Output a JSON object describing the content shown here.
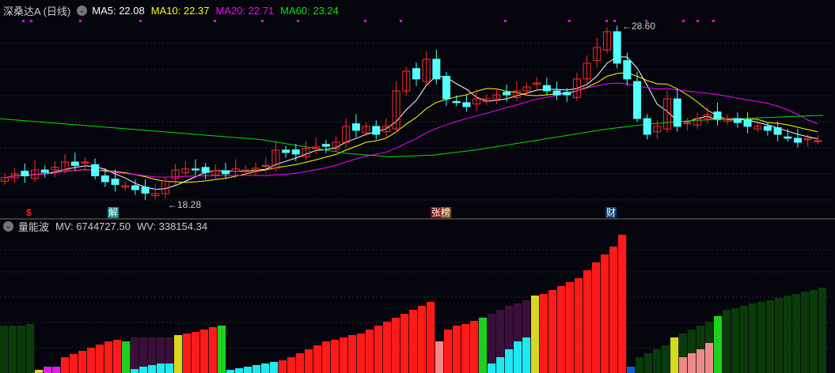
{
  "header": {
    "title": "深桑达A (日线)",
    "ma5": "MA5: 22.08",
    "ma10": "MA10: 22.37",
    "ma20": "MA20: 22.71",
    "ma60": "MA60: 23.24"
  },
  "colors": {
    "up": "#ff2b2b",
    "down": "#54ffff",
    "ma5": "#ffffff",
    "ma10": "#ffff00",
    "ma20": "#ff00ff",
    "ma60": "#00e000"
  },
  "price_annotations": {
    "high": "28.60",
    "low": "18.28"
  },
  "markers": [
    {
      "label": "$",
      "color": "#ff2020"
    },
    {
      "label": "解",
      "color": "#0e8a8a"
    },
    {
      "label": "张榜",
      "color": "#8a0a0a"
    },
    {
      "label": "财",
      "color": "#0a3f7a"
    }
  ],
  "indicator": {
    "name": "量能波",
    "mv": "MV: 6744727.50",
    "wv": "WV: 338154.34"
  },
  "chart_data": {
    "type": "candlestick",
    "close": [
      19.79,
      20.02,
      19.9,
      20.24,
      20.1,
      20.4,
      20.7,
      20.5,
      20.7,
      19.9,
      19.56,
      19.4,
      19.33,
      19.1,
      18.9,
      18.87,
      19.6,
      20.24,
      20.3,
      20.24,
      20.1,
      20.2,
      20.02,
      20.3,
      20.24,
      20.34,
      20.5,
      21.39,
      21.25,
      21.16,
      21.48,
      21.57,
      21.61,
      21.84,
      22.76,
      22.53,
      22.76,
      22.3,
      22.76,
      24.81,
      25.95,
      25.5,
      26.64,
      25.5,
      24.35,
      24.13,
      23.9,
      24.35,
      24.35,
      24.58,
      24.58,
      24.81,
      25.04,
      25.27,
      24.81,
      24.58,
      24.58,
      25.5,
      26.41,
      27.32,
      28.23,
      26.41,
      25.5,
      23.21,
      22.3,
      22.76,
      24.35,
      22.76,
      22.98,
      23.21,
      23.44,
      23.21,
      23.21,
      22.98,
      22.76,
      22.76,
      22.53,
      22.3,
      22.07,
      21.84,
      22.07,
      21.93
    ],
    "ma60": [
      23.2,
      23.0,
      22.8,
      22.6,
      22.4,
      22.2,
      22.0,
      21.6,
      21.2,
      21.0,
      21.1,
      21.4,
      21.8,
      22.2,
      22.6,
      22.9,
      23.1,
      23.2,
      23.3,
      23.4
    ],
    "high": 28.6,
    "low": 18.28,
    "volume_bars": [
      [
        60,
        "dg"
      ],
      [
        60,
        "dg"
      ],
      [
        60,
        "dg"
      ],
      [
        62,
        "dg"
      ],
      [
        4,
        "yl"
      ],
      [
        8,
        "mg"
      ],
      [
        8,
        "mg"
      ],
      [
        20,
        "rd"
      ],
      [
        24,
        "rd"
      ],
      [
        28,
        "rd"
      ],
      [
        32,
        "rd"
      ],
      [
        36,
        "rd"
      ],
      [
        40,
        "rd"
      ],
      [
        42,
        "rd"
      ],
      [
        40,
        "gr"
      ],
      [
        45,
        "pu",
        5
      ],
      [
        45,
        "pu",
        8
      ],
      [
        45,
        "pu",
        10
      ],
      [
        45,
        "pu",
        12
      ],
      [
        45,
        "pu",
        12
      ],
      [
        48,
        "yl"
      ],
      [
        50,
        "rd"
      ],
      [
        52,
        "rd"
      ],
      [
        55,
        "rd"
      ],
      [
        58,
        "rd"
      ],
      [
        60,
        "gr"
      ],
      [
        4,
        "cy"
      ],
      [
        6,
        "cy"
      ],
      [
        8,
        "cy"
      ],
      [
        10,
        "cy"
      ],
      [
        12,
        "cy"
      ],
      [
        14,
        "cy"
      ],
      [
        16,
        "rd"
      ],
      [
        20,
        "rd"
      ],
      [
        25,
        "rd"
      ],
      [
        30,
        "rd"
      ],
      [
        35,
        "rd"
      ],
      [
        40,
        "rd"
      ],
      [
        42,
        "rd"
      ],
      [
        45,
        "rd"
      ],
      [
        48,
        "rd"
      ],
      [
        50,
        "rd"
      ],
      [
        55,
        "rd"
      ],
      [
        60,
        "rd"
      ],
      [
        65,
        "rd"
      ],
      [
        70,
        "rd"
      ],
      [
        75,
        "rd"
      ],
      [
        80,
        "rd"
      ],
      [
        85,
        "rd"
      ],
      [
        90,
        "rd"
      ],
      [
        40,
        "pk"
      ],
      [
        55,
        "rd"
      ],
      [
        60,
        "rd"
      ],
      [
        62,
        "rd"
      ],
      [
        66,
        "rd"
      ],
      [
        70,
        "gr"
      ],
      [
        75,
        "pu",
        12
      ],
      [
        80,
        "pu",
        20
      ],
      [
        85,
        "pu",
        30
      ],
      [
        88,
        "pu",
        40
      ],
      [
        92,
        "pu",
        45
      ],
      [
        98,
        "yl"
      ],
      [
        100,
        "rd"
      ],
      [
        105,
        "rd"
      ],
      [
        110,
        "rd"
      ],
      [
        115,
        "rd"
      ],
      [
        120,
        "rd"
      ],
      [
        130,
        "rd"
      ],
      [
        140,
        "rd"
      ],
      [
        150,
        "rd"
      ],
      [
        160,
        "rd"
      ],
      [
        175,
        "rd"
      ],
      [
        8,
        "bl"
      ],
      [
        20,
        "dg"
      ],
      [
        25,
        "dg"
      ],
      [
        30,
        "dg"
      ],
      [
        35,
        "dg"
      ],
      [
        45,
        "yl"
      ],
      [
        50,
        "dg",
        20
      ],
      [
        55,
        "dg",
        25
      ],
      [
        60,
        "dg",
        30
      ],
      [
        65,
        "dg",
        38
      ],
      [
        72,
        "gr"
      ],
      [
        80,
        "dg"
      ],
      [
        82,
        "dg"
      ],
      [
        85,
        "dg"
      ],
      [
        88,
        "dg"
      ],
      [
        90,
        "dg"
      ],
      [
        92,
        "dg"
      ],
      [
        95,
        "dg"
      ],
      [
        98,
        "dg"
      ],
      [
        100,
        "dg"
      ],
      [
        103,
        "dg"
      ],
      [
        105,
        "dg"
      ],
      [
        108,
        "dg"
      ]
    ]
  }
}
